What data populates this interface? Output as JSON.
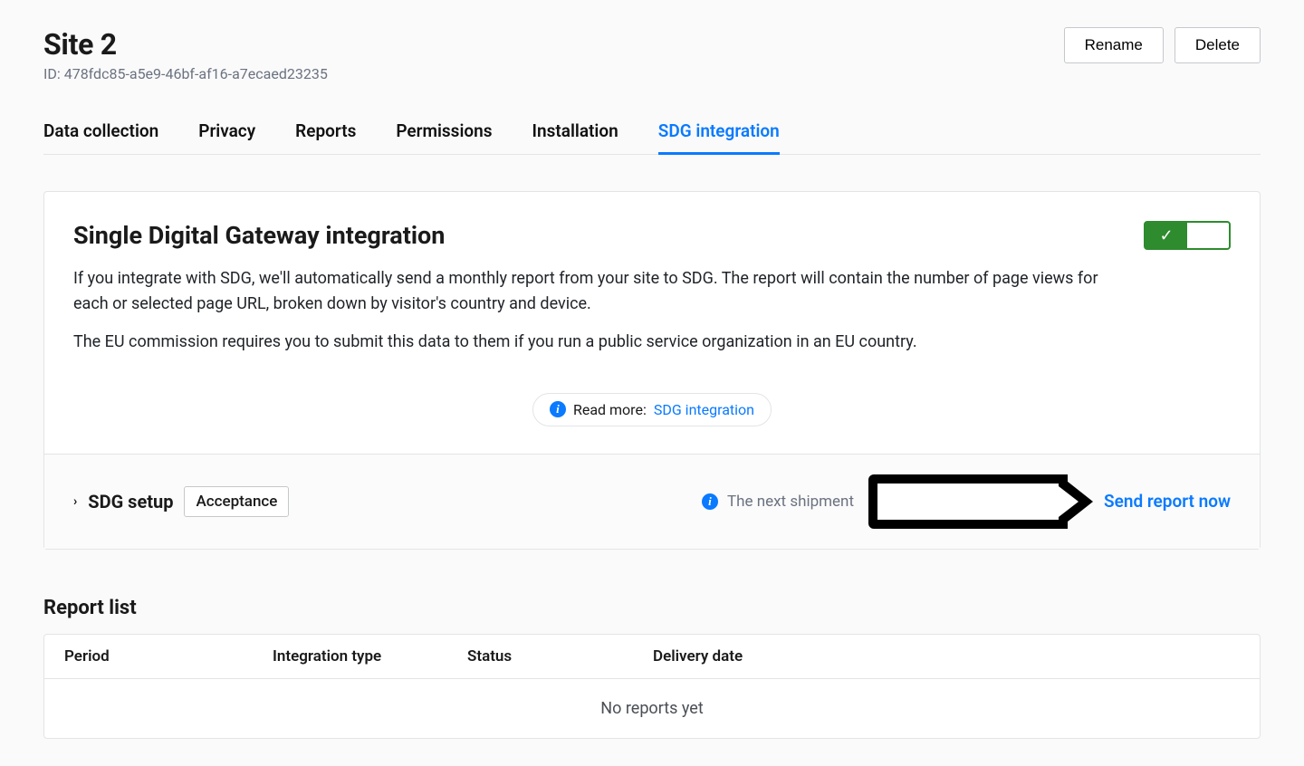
{
  "header": {
    "title": "Site 2",
    "id_prefix": "ID: ",
    "id_value": "478fdc85-a5e9-46bf-af16-a7ecaed23235",
    "rename_label": "Rename",
    "delete_label": "Delete"
  },
  "tabs": {
    "data_collection": "Data collection",
    "privacy": "Privacy",
    "reports": "Reports",
    "permissions": "Permissions",
    "installation": "Installation",
    "sdg_integration": "SDG integration"
  },
  "panel": {
    "heading": "Single Digital Gateway integration",
    "para1": "If you integrate with SDG, we'll automatically send a monthly report from your site to SDG. The report will contain the number of page views for each or selected page URL, broken down by visitor's country and device.",
    "para2": "The EU commission requires you to submit this data to them if you run a public service organization in an EU country.",
    "readmore_label": "Read more: ",
    "readmore_link": "SDG integration",
    "toggle_on": true
  },
  "setup": {
    "label": "SDG setup",
    "badge": "Acceptance",
    "shipment_label": "The next shipment",
    "send_now": "Send report now"
  },
  "report_list": {
    "heading": "Report list",
    "columns": {
      "period": "Period",
      "type": "Integration type",
      "status": "Status",
      "delivery": "Delivery date"
    },
    "empty": "No reports yet"
  }
}
